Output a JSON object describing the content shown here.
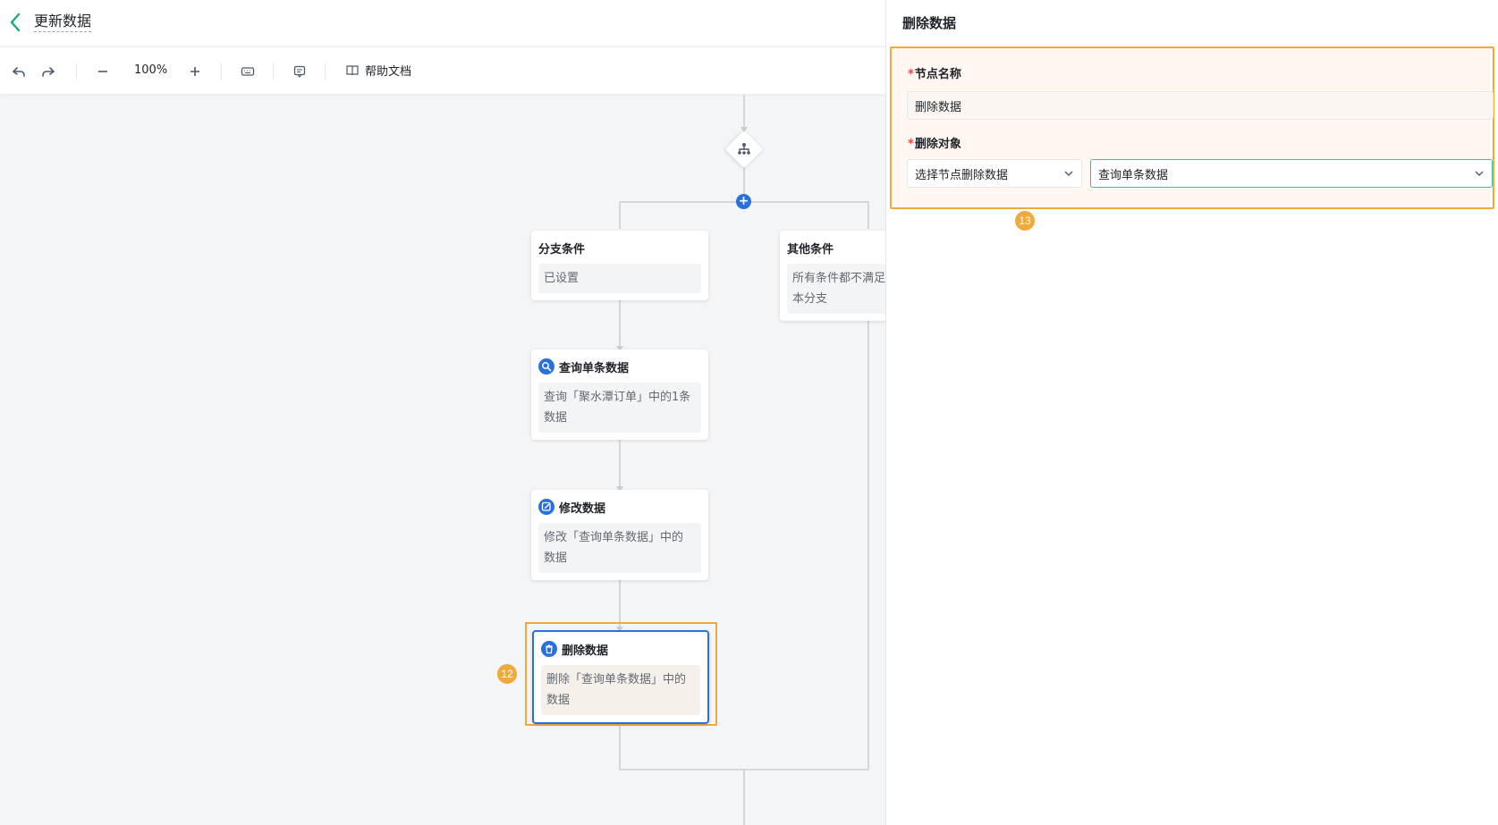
{
  "header": {
    "title": "更新数据"
  },
  "toolbar": {
    "zoom": "100%",
    "help_label": "帮助文档"
  },
  "flow": {
    "branch_condition": {
      "title": "分支条件",
      "body": "已设置"
    },
    "other_condition": {
      "title": "其他条件",
      "body_line1": "所有条件都不满足",
      "body_line2": "本分支"
    },
    "query_node": {
      "title": "查询单条数据",
      "body_line1": "查询「聚水潭订单」中的1条",
      "body_line2": "数据"
    },
    "update_node": {
      "title": "修改数据",
      "body_line1": "修改「查询单条数据」中的",
      "body_line2": "数据"
    },
    "delete_node": {
      "title": "删除数据",
      "body_line1": "删除「查询单条数据」中的",
      "body_line2": "数据"
    },
    "badge_12": "12"
  },
  "panel": {
    "title": "删除数据",
    "name_label": "节点名称",
    "name_value": "删除数据",
    "object_label": "删除对象",
    "select_mode": "选择节点删除数据",
    "select_object": "查询单条数据",
    "badge_13": "13",
    "required_mark": "*"
  },
  "colors": {
    "accent": "#2a6fde",
    "highlight": "#f0a93b",
    "back": "#19a97b",
    "focus": "#3fbf9f"
  },
  "icons": [
    "back-arrow-icon",
    "undo-icon",
    "redo-icon",
    "zoom-out-icon",
    "zoom-in-icon",
    "keyboard-icon",
    "comment-icon",
    "book-icon",
    "branch-icon",
    "add-icon",
    "search-icon",
    "edit-icon",
    "trash-icon",
    "chevron-down-icon"
  ]
}
